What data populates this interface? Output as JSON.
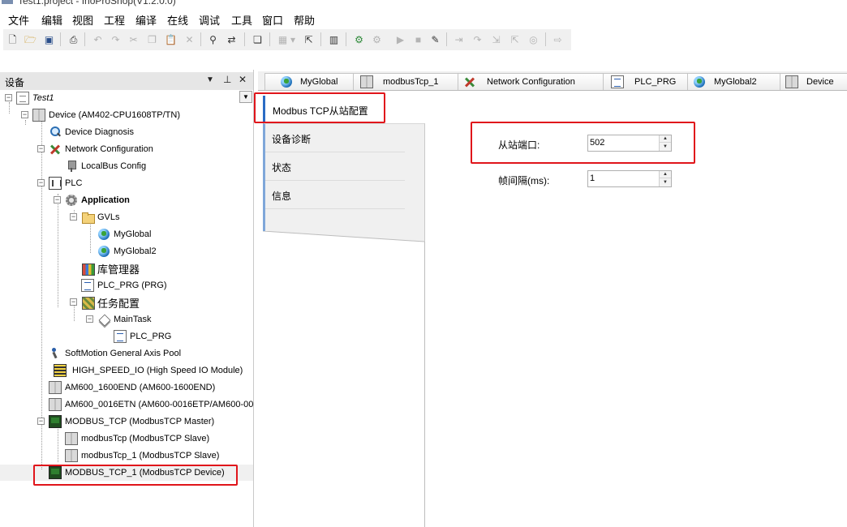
{
  "window": {
    "title": "Test1.project - InoProShop(V1.2.0.0)"
  },
  "menu": {
    "items": [
      "文件",
      "编辑",
      "视图",
      "工程",
      "编译",
      "在线",
      "调试",
      "工具",
      "窗口",
      "帮助"
    ]
  },
  "toolbar": {
    "icons": [
      "new-file-icon",
      "open-folder-icon",
      "save-icon",
      "print-icon",
      "undo-icon",
      "redo-icon",
      "cut-icon",
      "copy-icon",
      "paste-icon",
      "delete-icon",
      "find-icon",
      "find-replace-icon",
      "window-icon",
      "grid-icon",
      "dropdown-icon",
      "export-icon",
      "device-icon",
      "login-icon",
      "logout-icon",
      "run-icon",
      "stop-icon",
      "tools-icon",
      "step-icon",
      "step-over-icon",
      "step-into-icon",
      "step-out-icon",
      "breakpoint-icon",
      "goto-icon"
    ]
  },
  "device_panel": {
    "title": "设备",
    "dropdown_icon": "chevron-down-icon",
    "pin_icon": "pin-icon",
    "close_icon": "close-icon",
    "tree": [
      {
        "label": "Test1",
        "icon": "project-icon"
      },
      {
        "label": "Device (AM402-CPU1608TP/TN)",
        "icon": "device-icon"
      },
      {
        "label": "Device Diagnosis",
        "icon": "diagnosis-icon"
      },
      {
        "label": "Network Configuration",
        "icon": "network-config-icon"
      },
      {
        "label": "LocalBus Config",
        "icon": "localbus-icon"
      },
      {
        "label": "PLC",
        "icon": "plc-icon"
      },
      {
        "label": "Application",
        "icon": "application-gear-icon"
      },
      {
        "label": "GVLs",
        "icon": "folder-icon"
      },
      {
        "label": "MyGlobal",
        "icon": "globe-icon"
      },
      {
        "label": "MyGlobal2",
        "icon": "globe-icon"
      },
      {
        "label": "库管理器",
        "icon": "library-icon"
      },
      {
        "label": "PLC_PRG (PRG)",
        "icon": "program-icon"
      },
      {
        "label": "任务配置",
        "icon": "task-config-icon"
      },
      {
        "label": "MainTask",
        "icon": "task-icon"
      },
      {
        "label": "PLC_PRG",
        "icon": "program-call-icon"
      },
      {
        "label": "SoftMotion General Axis Pool",
        "icon": "softmotion-icon"
      },
      {
        "label": "HIGH_SPEED_IO (High Speed IO Module)",
        "icon": "io-module-icon"
      },
      {
        "label": "AM600_1600END (AM600-1600END)",
        "icon": "module-icon"
      },
      {
        "label": "AM600_0016ETN (AM600-0016ETP/AM600-0016ETN)",
        "icon": "module-icon"
      },
      {
        "label": "MODBUS_TCP (ModbusTCP Master)",
        "icon": "modbus-master-icon"
      },
      {
        "label": "modbusTcp (ModbusTCP Slave)",
        "icon": "modbus-slave-icon"
      },
      {
        "label": "modbusTcp_1 (ModbusTCP Slave)",
        "icon": "modbus-slave-icon"
      },
      {
        "label": "MODBUS_TCP_1 (ModbusTCP Device)",
        "icon": "modbus-device-icon"
      }
    ]
  },
  "editor_tabs": [
    {
      "label": "MyGlobal",
      "icon": "globe-icon"
    },
    {
      "label": "modbusTcp_1",
      "icon": "modbus-slave-icon"
    },
    {
      "label": "Network Configuration",
      "icon": "network-config-icon"
    },
    {
      "label": "PLC_PRG",
      "icon": "program-icon"
    },
    {
      "label": "MyGlobal2",
      "icon": "globe-icon"
    },
    {
      "label": "Device",
      "icon": "device-icon"
    }
  ],
  "config_tabs": {
    "active": "Modbus TCP从站配置",
    "items": [
      "设备诊断",
      "状态",
      "信息"
    ]
  },
  "fields": {
    "slave_port": {
      "label": "从站端口:",
      "value": "502"
    },
    "frame_interval": {
      "label": "帧间隔(ms):",
      "value": "1"
    }
  },
  "colors": {
    "highlight_border": "#e0151b",
    "active_tab_accent": "#2b6cc4"
  }
}
